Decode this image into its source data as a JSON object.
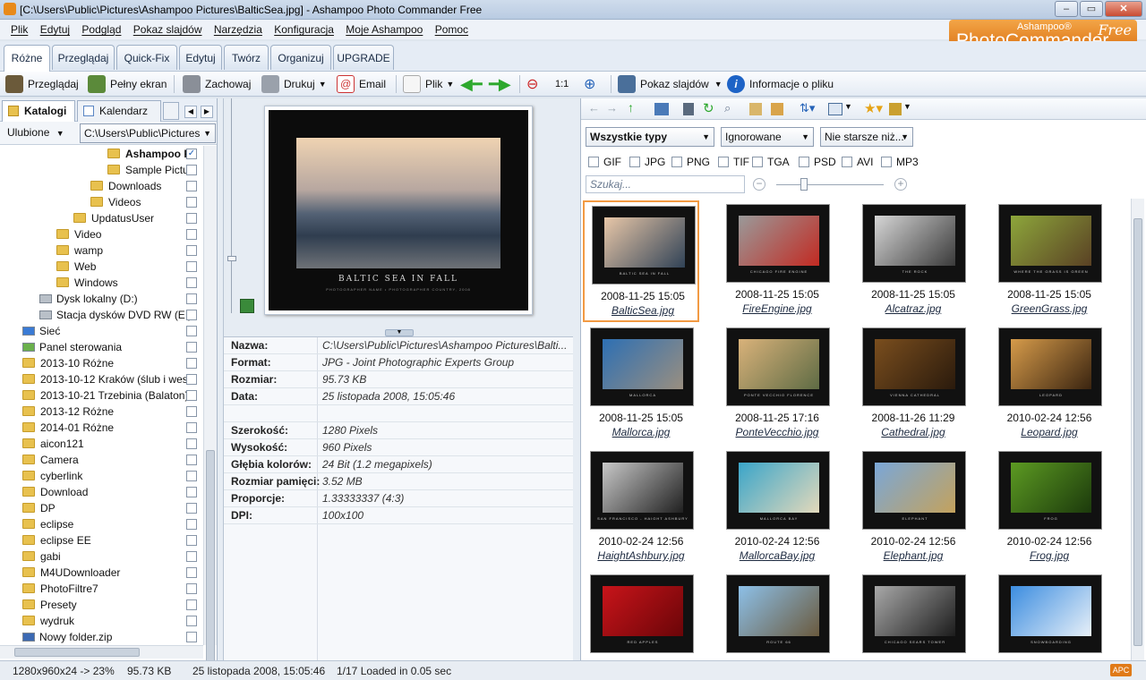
{
  "window": {
    "title": "[C:\\Users\\Public\\Pictures\\Ashampoo Pictures\\BalticSea.jpg] - Ashampoo Photo Commander Free"
  },
  "menu": [
    "Plik",
    "Edytuj",
    "Podgląd",
    "Pokaz slajdów",
    "Narzędzia",
    "Konfiguracja",
    "Moje Ashampoo",
    "Pomoc"
  ],
  "brand": {
    "small": "Ashampoo®",
    "main": "PhotoCommander",
    "free": "Free"
  },
  "tabs": [
    "Różne",
    "Przeglądaj",
    "Quick-Fix",
    "Edytuj",
    "Twórz",
    "Organizuj",
    "UPGRADE"
  ],
  "toolbar": {
    "browse": "Przeglądaj",
    "fullscreen": "Pełny ekran",
    "save": "Zachowaj",
    "print": "Drukuj",
    "email": "Email",
    "file": "Plik",
    "slideshow": "Pokaz slajdów",
    "fileinfo": "Informacje o pliku"
  },
  "left": {
    "tab_catalogs": "Katalogi",
    "tab_calendar": "Kalendarz",
    "favorites": "Ulubione",
    "path": "C:\\Users\\Public\\Pictures",
    "items": [
      {
        "label": "Ashampoo P",
        "icon": "folder",
        "checked": true,
        "bold": true
      },
      {
        "label": "Sample Pictu",
        "icon": "folder"
      },
      {
        "label": "Downloads",
        "icon": "folder"
      },
      {
        "label": "Videos",
        "icon": "folder"
      },
      {
        "label": "UpdatusUser",
        "icon": "folder"
      },
      {
        "label": "Video",
        "icon": "folder"
      },
      {
        "label": "wamp",
        "icon": "folder"
      },
      {
        "label": "Web",
        "icon": "folder"
      },
      {
        "label": "Windows",
        "icon": "folder"
      },
      {
        "label": "Dysk lokalny (D:)",
        "icon": "drive"
      },
      {
        "label": "Stacja dysków DVD RW (E:)",
        "icon": "drive"
      },
      {
        "label": "Sieć",
        "icon": "network"
      },
      {
        "label": "Panel sterowania",
        "icon": "panel"
      },
      {
        "label": "2013-10 Różne",
        "icon": "folder"
      },
      {
        "label": "2013-10-12 Kraków (ślub i wese",
        "icon": "folder"
      },
      {
        "label": "2013-10-21 Trzebinia (Balaton)",
        "icon": "folder"
      },
      {
        "label": "2013-12 Różne",
        "icon": "folder"
      },
      {
        "label": "2014-01 Różne",
        "icon": "folder"
      },
      {
        "label": "aicon121",
        "icon": "folder"
      },
      {
        "label": "Camera",
        "icon": "folder"
      },
      {
        "label": "cyberlink",
        "icon": "folder"
      },
      {
        "label": "Download",
        "icon": "folder"
      },
      {
        "label": "DP",
        "icon": "folder"
      },
      {
        "label": "eclipse",
        "icon": "folder"
      },
      {
        "label": "eclipse EE",
        "icon": "folder"
      },
      {
        "label": "gabi",
        "icon": "folder"
      },
      {
        "label": "M4UDownloader",
        "icon": "folder"
      },
      {
        "label": "PhotoFiltre7",
        "icon": "folder"
      },
      {
        "label": "Presety",
        "icon": "folder"
      },
      {
        "label": "wydruk",
        "icon": "folder"
      },
      {
        "label": "Nowy folder.zip",
        "icon": "zip"
      }
    ]
  },
  "preview": {
    "caption": "BALTIC SEA IN FALL",
    "subcaption": "PHOTOGRAPHER NAME • PHOTOGRAPHER COUNTRY, 2008"
  },
  "props": [
    {
      "k": "Nazwa:",
      "v": "C:\\Users\\Public\\Pictures\\Ashampoo Pictures\\Balti..."
    },
    {
      "k": "Format:",
      "v": "JPG - Joint Photographic Experts Group"
    },
    {
      "k": "Rozmiar:",
      "v": "95.73 KB"
    },
    {
      "k": "Data:",
      "v": "25 listopada 2008, 15:05:46"
    },
    {
      "k": "",
      "v": ""
    },
    {
      "k": "Szerokość:",
      "v": "1280 Pixels"
    },
    {
      "k": "Wysokość:",
      "v": "960 Pixels"
    },
    {
      "k": "Głębia kolorów:",
      "v": "24 Bit (1.2 megapixels)"
    },
    {
      "k": "Rozmiar pamięci:",
      "v": "3.52 MB"
    },
    {
      "k": "Proporcje:",
      "v": "1.33333337 (4:3)"
    },
    {
      "k": "DPI:",
      "v": "100x100"
    }
  ],
  "filter": {
    "types": "Wszystkie typy",
    "ignored": "Ignorowane",
    "age": "Nie starsze niż...",
    "filetypes": [
      "GIF",
      "JPG",
      "PNG",
      "TIF",
      "TGA",
      "PSD",
      "AVI",
      "MP3"
    ],
    "search_placeholder": "Szukaj..."
  },
  "thumbs": [
    {
      "date": "2008-11-25 15:05",
      "name": "BalticSea.jpg",
      "cap": "BALTIC SEA IN FALL",
      "c1": "#e8c7a8",
      "c2": "#304256",
      "selected": true
    },
    {
      "date": "2008-11-25 15:05",
      "name": "FireEngine.jpg",
      "cap": "CHICAGO FIRE ENGINE",
      "c1": "#9a9a9a",
      "c2": "#c22a22"
    },
    {
      "date": "2008-11-25 15:05",
      "name": "Alcatraz.jpg",
      "cap": "THE ROCK",
      "c1": "#d6d6d6",
      "c2": "#3a3a3a"
    },
    {
      "date": "2008-11-25 15:05",
      "name": "GreenGrass.jpg",
      "cap": "WHERE THE GRASS IS GREEN",
      "c1": "#8da63b",
      "c2": "#5a4124"
    },
    {
      "date": "2008-11-25 15:05",
      "name": "Mallorca.jpg",
      "cap": "MALLORCA",
      "c1": "#2d6fb3",
      "c2": "#9a8f80"
    },
    {
      "date": "2008-11-25 17:16",
      "name": "PonteVecchio.jpg",
      "cap": "PONTE VECCHIO FLORENCE",
      "c1": "#d9b27a",
      "c2": "#5e6b44"
    },
    {
      "date": "2008-11-26 11:29",
      "name": "Cathedral.jpg",
      "cap": "VIENNA CATHEDRAL",
      "c1": "#7a4e1e",
      "c2": "#2a1a0c"
    },
    {
      "date": "2010-02-24 12:56",
      "name": "Leopard.jpg",
      "cap": "LEOPARD",
      "c1": "#d69b4a",
      "c2": "#3a2410"
    },
    {
      "date": "2010-02-24 12:56",
      "name": "HaightAshbury.jpg",
      "cap": "SAN FRANCISCO - HAIGHT ASHBURY",
      "c1": "#c8c8c8",
      "c2": "#202020"
    },
    {
      "date": "2010-02-24 12:56",
      "name": "MallorcaBay.jpg",
      "cap": "MALLORCA BAY",
      "c1": "#3aa5c9",
      "c2": "#e3d9bb"
    },
    {
      "date": "2010-02-24 12:56",
      "name": "Elephant.jpg",
      "cap": "ELEPHANT",
      "c1": "#7aa7d8",
      "c2": "#c4a25c"
    },
    {
      "date": "2010-02-24 12:56",
      "name": "Frog.jpg",
      "cap": "FROG",
      "c1": "#5c9a22",
      "c2": "#1c3a0c"
    },
    {
      "date": "",
      "name": "",
      "cap": "RED APPLES",
      "c1": "#c8141a",
      "c2": "#6a0508"
    },
    {
      "date": "",
      "name": "",
      "cap": "ROUTE 66",
      "c1": "#8dc0e8",
      "c2": "#6a5a3e"
    },
    {
      "date": "",
      "name": "",
      "cap": "CHICAGO SEARS TOWER",
      "c1": "#a8a8a8",
      "c2": "#1c1c1c"
    },
    {
      "date": "",
      "name": "",
      "cap": "SNOWBOARDING",
      "c1": "#3c8de0",
      "c2": "#e8f0f8"
    }
  ],
  "status": {
    "dims": "1280x960x24 -> 23%",
    "size": "95.73 KB",
    "date": "25 listopada 2008, 15:05:46",
    "info": "1/17  Loaded in 0.05 sec"
  },
  "colors": {
    "accent": "#e07a18",
    "selected_border": "#f29a43"
  }
}
